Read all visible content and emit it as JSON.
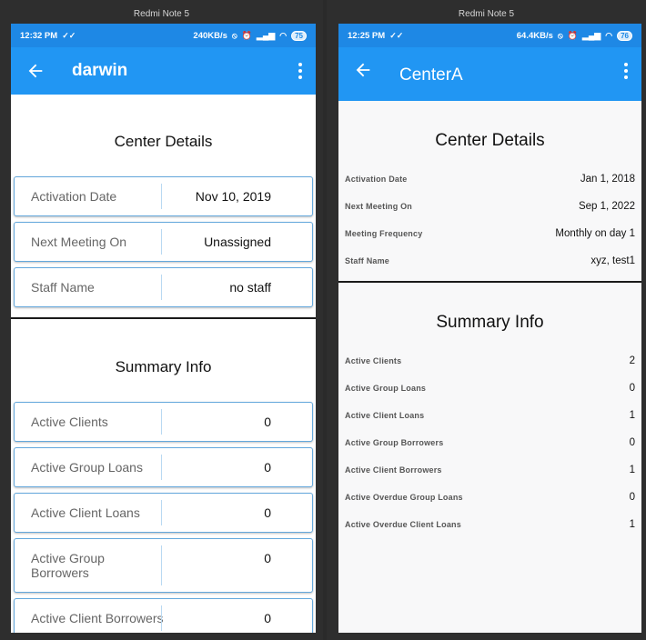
{
  "left": {
    "window_title": "Redmi Note 5",
    "status": {
      "time": "12:32 PM",
      "speed": "240KB/s",
      "battery": "75"
    },
    "app_title": "darwin",
    "center_details_title": "Center Details",
    "center_details": [
      {
        "label": "Activation Date",
        "value": "Nov 10, 2019"
      },
      {
        "label": "Next Meeting On",
        "value": "Unassigned"
      },
      {
        "label": "Staff Name",
        "value": "no staff"
      }
    ],
    "summary_title": "Summary Info",
    "summary": [
      {
        "label": "Active Clients",
        "value": "0"
      },
      {
        "label": "Active Group Loans",
        "value": "0"
      },
      {
        "label": "Active Client Loans",
        "value": "0"
      },
      {
        "label": "Active Group Borrowers",
        "value": "0"
      },
      {
        "label": "Active Client Borrowers",
        "value": "0"
      }
    ]
  },
  "right": {
    "window_title": "Redmi Note 5",
    "status": {
      "time": "12:25 PM",
      "speed": "64.4KB/s",
      "battery": "76"
    },
    "app_title": "CenterA",
    "center_details_title": "Center Details",
    "center_details": [
      {
        "label": "Activation Date",
        "value": "Jan 1, 2018"
      },
      {
        "label": "Next Meeting On",
        "value": "Sep 1, 2022"
      },
      {
        "label": "Meeting Frequency",
        "value": "Monthly on day 1"
      },
      {
        "label": "Staff Name",
        "value": "xyz, test1"
      }
    ],
    "summary_title": "Summary Info",
    "summary": [
      {
        "label": "Active Clients",
        "value": "2"
      },
      {
        "label": "Active Group Loans",
        "value": "0"
      },
      {
        "label": "Active Client Loans",
        "value": "1"
      },
      {
        "label": "Active Group Borrowers",
        "value": "0"
      },
      {
        "label": "Active Client Borrowers",
        "value": "1"
      },
      {
        "label": "Active Overdue Group Loans",
        "value": "0"
      },
      {
        "label": "Active Overdue Client Loans",
        "value": "1"
      }
    ]
  },
  "colors": {
    "status_bar": "#1e88e5",
    "app_bar": "#2196f3",
    "card_border": "#64a8dc"
  },
  "icons": [
    "back-arrow-icon",
    "more-vert-icon",
    "alarm-icon",
    "signal-icon",
    "wifi-icon",
    "battery-icon"
  ]
}
